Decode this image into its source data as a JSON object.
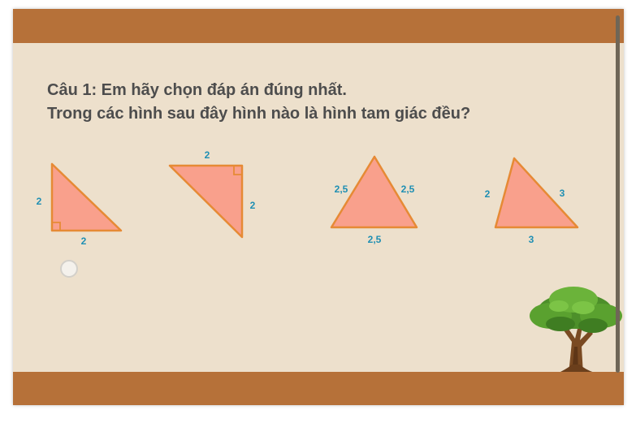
{
  "question": {
    "line1": "Câu 1: Em hãy chọn đáp án đúng nhất.",
    "line2": "Trong các hình sau đây hình nào là hình tam giác đều?"
  },
  "figures": {
    "tri1": {
      "left": "2",
      "bottom": "2"
    },
    "tri2": {
      "top": "2",
      "right": "2"
    },
    "tri3": {
      "left": "2,5",
      "right": "2,5",
      "bottom": "2,5"
    },
    "tri4": {
      "left": "2",
      "right": "3",
      "bottom": "3"
    }
  },
  "colors": {
    "band": "#b67139",
    "background": "#ede0cc",
    "triangle_fill": "#f9a08c",
    "triangle_stroke": "#e68a35",
    "label": "#1f8fb3",
    "question_text": "#4d4d4d"
  },
  "icons": [
    "right-angle-mark",
    "tree-illustration",
    "radio-button"
  ]
}
